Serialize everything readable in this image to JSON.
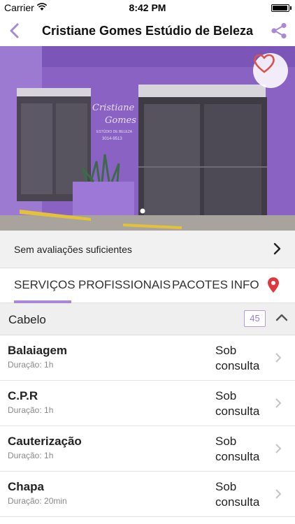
{
  "status_bar": {
    "carrier": "Carrier",
    "time": "8:42 PM",
    "battery_level": 0.95
  },
  "nav": {
    "title": "Cristiane Gomes Estúdio de Beleza",
    "back_icon": "chevron-left-icon",
    "share_icon": "share-icon"
  },
  "hero": {
    "favorite_icon": "heart-icon",
    "storefront_sign_line1": "Cristiane",
    "storefront_sign_line2": "Gomes",
    "storefront_sign_line3": "ESTÚDIO DE BELEZA",
    "storefront_sign_line4": "3014-9513"
  },
  "rating": {
    "text": "Sem avaliações suficientes"
  },
  "tabs": [
    {
      "label": "SERVIÇOS",
      "active": true
    },
    {
      "label": "PROFISSIONAIS",
      "active": false
    },
    {
      "label": "PACOTES",
      "active": false
    },
    {
      "label": "INFO",
      "active": false
    }
  ],
  "location_icon": "map-pin-icon",
  "category": {
    "name": "Cabelo",
    "count": "45"
  },
  "services": [
    {
      "name": "Balaiagem",
      "duration": "Duração: 1h",
      "price_line1": "Sob",
      "price_line2": "consulta"
    },
    {
      "name": "C.P.R",
      "duration": "Duração: 1h",
      "price_line1": "Sob",
      "price_line2": "consulta"
    },
    {
      "name": "Cauterização",
      "duration": "Duração: 1h",
      "price_line1": "Sob",
      "price_line2": "consulta"
    },
    {
      "name": "Chapa",
      "duration": "Duração: 20min",
      "price_line1": "Sob",
      "price_line2": "consulta"
    }
  ],
  "colors": {
    "accent": "#a989d6",
    "heart": "#d9534f",
    "pin": "#e0373f",
    "facade": "#8a62c4"
  }
}
